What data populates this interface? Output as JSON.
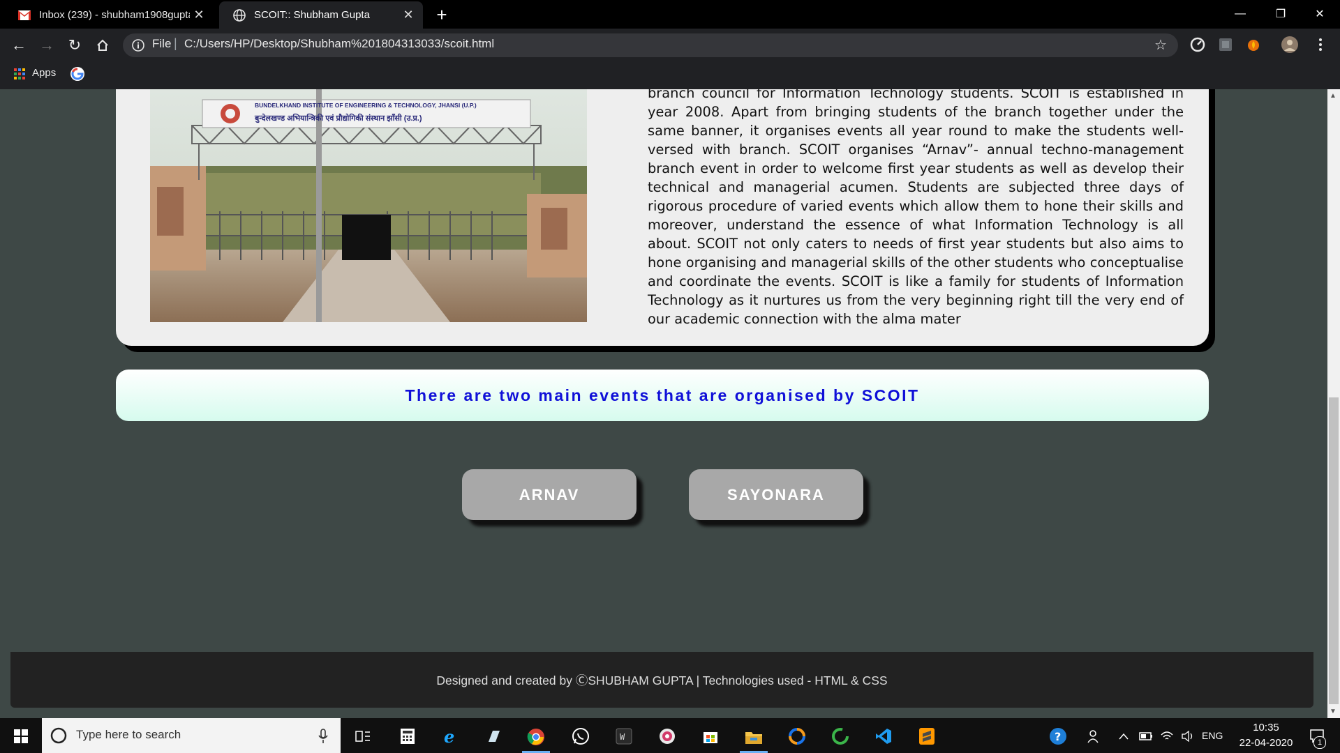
{
  "browser": {
    "tabs": [
      {
        "title": "Inbox (239) - shubham1908gupta",
        "icon": "gmail-icon",
        "active": false
      },
      {
        "title": "SCOIT:: Shubham Gupta",
        "icon": "globe-icon",
        "active": true
      }
    ],
    "address": {
      "scheme_label": "File",
      "separator": "|",
      "url": "C:/Users/HP/Desktop/Shubham%201804313033/scoit.html"
    },
    "bookmarks": {
      "apps_label": "Apps"
    }
  },
  "page": {
    "about_text": "branch council for Information Technology students. SCOIT is established in year 2008. Apart from bringing students of the branch together under the same banner, it organises events all year round to make the students well-versed with branch. SCOIT organises “Arnav”- annual techno-management branch event in order to welcome first year students as well as develop their technical and managerial acumen. Students are subjected three days of rigorous procedure of varied events which allow them to hone their skills and moreover, understand the essence of what Information Technology is all about. SCOIT not only caters to needs of first year students but also aims to hone organising and managerial skills of the other students who conceptualise and coordinate the events. SCOIT is like a family for students of Information Technology as it nurtures us from the very beginning right till the very end of our academic connection with the alma mater",
    "photo": {
      "sign_en": "BUNDELKHAND INSTITUTE OF ENGINEERING & TECHNOLOGY, JHANSI (U.P.)",
      "sign_hi": "बुन्देलखण्ड अभियान्त्रिकी एवं प्रौद्योगिकी संस्थान झाँसी (उ.प्र.)"
    },
    "events_heading": "There are two main events that are organised by SCOIT",
    "event_buttons": [
      "ARNAV",
      "SAYONARA"
    ],
    "footer": "Designed and created by ⒸSHUBHAM GUPTA | Technologies used - HTML & CSS"
  },
  "taskbar": {
    "search_placeholder": "Type here to search",
    "language": "ENG",
    "time": "10:35",
    "date": "22-04-2020",
    "notification_count": "1"
  },
  "colors": {
    "page_bg": "#3e4846",
    "card_bg": "#eeeeee",
    "heading_blue": "#1010d8",
    "button_gray": "#a8a8a8",
    "footer_bg": "#222222"
  }
}
